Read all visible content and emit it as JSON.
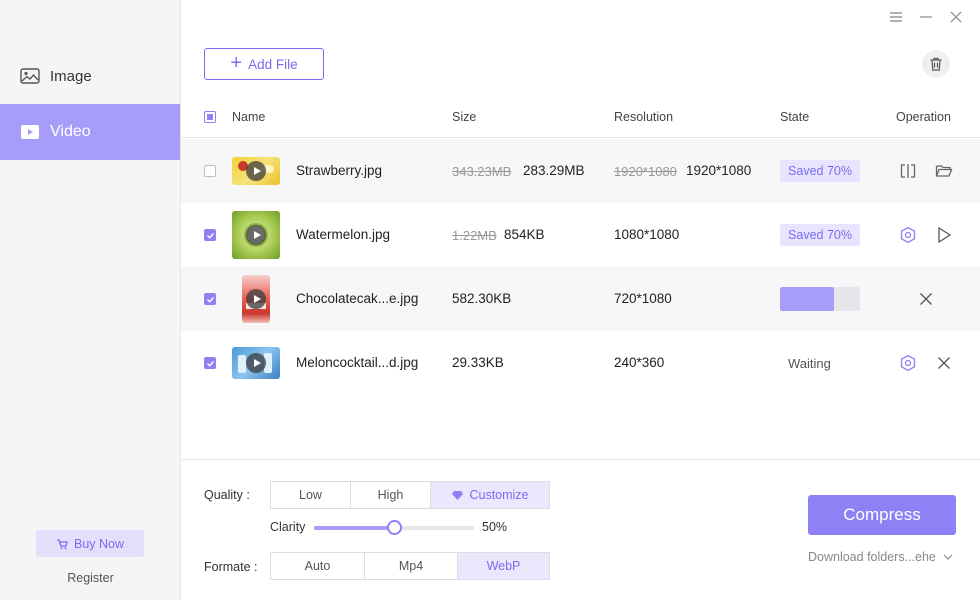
{
  "sidebar": {
    "items": [
      {
        "label": "Image",
        "icon": "image-icon",
        "active": false
      },
      {
        "label": "Video",
        "icon": "video-icon",
        "active": true
      }
    ],
    "buy_now": "Buy Now",
    "register": "Register"
  },
  "window_controls": [
    "menu-icon",
    "minimize-icon",
    "close-icon"
  ],
  "toolbar": {
    "add_file": "Add File",
    "trash_icon": "trash-icon"
  },
  "table": {
    "headers": {
      "name": "Name",
      "size": "Size",
      "resolution": "Resolution",
      "state": "State",
      "operation": "Operation"
    },
    "rows": [
      {
        "checked": false,
        "name": "Strawberry.jpg",
        "old_size": "343.23MB",
        "size": "283.29MB",
        "old_resolution": "1920*1080",
        "resolution": "1920*1080",
        "state": "Saved 70%",
        "progress": null,
        "ops": [
          "compare-icon",
          "folder-icon"
        ]
      },
      {
        "checked": true,
        "name": "Watermelon.jpg",
        "old_size": "1.22MB",
        "size": "854KB",
        "old_resolution": "",
        "resolution": "1080*1080",
        "state": "Saved 70%",
        "progress": null,
        "ops": [
          "settings-icon",
          "play-icon"
        ]
      },
      {
        "checked": true,
        "name": "Chocolatecak...e.jpg",
        "old_size": "",
        "size": "582.30KB",
        "old_resolution": "",
        "resolution": "720*1080",
        "state": "",
        "progress": 0.68,
        "ops": [
          "close-icon"
        ]
      },
      {
        "checked": true,
        "name": "Meloncocktail...d.jpg",
        "old_size": "",
        "size": "29.33KB",
        "old_resolution": "",
        "resolution": "240*360",
        "state": "Waiting",
        "progress": null,
        "ops": [
          "settings-icon",
          "close-icon"
        ]
      }
    ]
  },
  "settings": {
    "quality_label": "Quality :",
    "quality_options": [
      "Low",
      "High",
      "Customize"
    ],
    "quality_selected": "Customize",
    "clarity_label": "Clarity",
    "clarity_value": "50%",
    "clarity_fraction": 0.5,
    "format_label": "Formate :",
    "format_options": [
      "Auto",
      "Mp4",
      "WebP"
    ],
    "format_selected": "WebP"
  },
  "compress_button": "Compress",
  "download_folder": "Download folders...ehe",
  "colors": {
    "accent": "#8e80f5",
    "accent_light": "#a79cf8",
    "badge_bg": "#e8e4fd"
  }
}
